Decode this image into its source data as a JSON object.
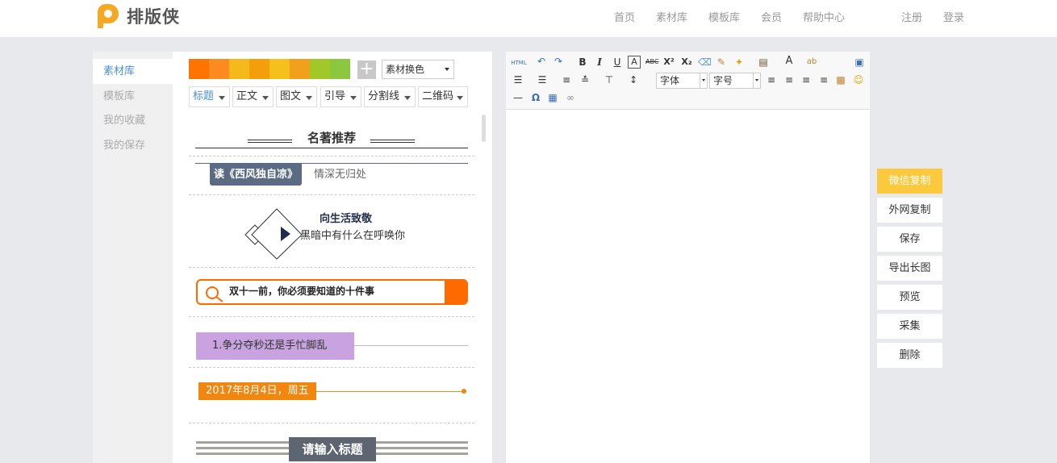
{
  "header": {
    "logo_text": "排版侠",
    "nav": [
      "首页",
      "素材库",
      "模板库",
      "会员",
      "帮助中心"
    ],
    "register": "注册",
    "login": "登录"
  },
  "sidebar": {
    "items": [
      {
        "label": "素材库",
        "active": true
      },
      {
        "label": "模板库",
        "active": false
      },
      {
        "label": "我的收藏",
        "active": false
      },
      {
        "label": "我的保存",
        "active": false
      }
    ]
  },
  "materials": {
    "swatches": [
      "#ff7300",
      "#ff8a1f",
      "#f5b91b",
      "#f59e0b",
      "#f5c01b",
      "#f0a01a",
      "#a0c828",
      "#8dc63f"
    ],
    "recolor_select": "素材换色",
    "tabs": [
      "标题",
      "正文",
      "图文",
      "引导",
      "分割线",
      "二维码"
    ],
    "items": {
      "title1": "名著推荐",
      "title2_tag": "读《西风独自凉》",
      "title2_text": "情深无归处",
      "title3_line1": "向生活致敬",
      "title3_line2": "黑暗中有什么在呼唤你",
      "title4": "双十一前，你必须要知道的十件事",
      "title5": "1.争分夺秒还是手忙脚乱",
      "title6": "2017年8月4日，周五",
      "title7": "请输入标题"
    }
  },
  "editor": {
    "toolbar": {
      "html_label": "HTML",
      "font_family": "字体",
      "font_size": "字号"
    }
  },
  "actions": {
    "wechat_copy": "微信复制",
    "external_copy": "外网复制",
    "save": "保存",
    "export_long_image": "导出长图",
    "preview": "预览",
    "collect": "采集",
    "delete": "删除"
  },
  "colors": {
    "accent": "#4a90d9",
    "primary_action": "#fcc93c",
    "orange": "#ff6a00",
    "purple": "#c9a3df",
    "slate": "#5a6b83"
  }
}
